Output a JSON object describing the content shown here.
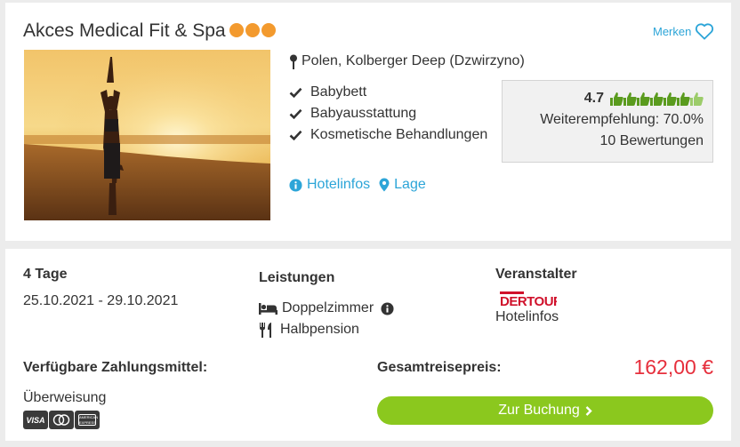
{
  "hotel": {
    "name": "Akces Medical Fit & Spa",
    "star_count": 3,
    "star_color": "#f39a2e",
    "location": "Polen, Kolberger Deep (Dzwirzyno)",
    "features": [
      "Babybett",
      "Babyausstattung",
      "Kosmetische Behandlungen"
    ]
  },
  "actions": {
    "merken_label": "Merken",
    "hotelinfos_link": "Hotelinfos",
    "lage_link": "Lage"
  },
  "rating": {
    "score": "4.7",
    "thumbs_full": 6,
    "thumbs_total": 7,
    "recommendation": "Weiterempfehlung: 70.0%",
    "reviews": "10 Bewertungen",
    "thumb_color": "#5a9b1e",
    "thumb_light_color": "#9ccc6a"
  },
  "offer": {
    "duration": "4 Tage",
    "dates": "25.10.2021 - 29.10.2021",
    "services_heading": "Leistungen",
    "room": "Doppelzimmer",
    "board": "Halbpension",
    "operator_heading": "Veranstalter",
    "operator_logo_text": "DERTOUR",
    "operator_link": "Hotelinfos",
    "payment_heading": "Verfügbare Zahlungsmittel:",
    "payment_method": "Überweisung",
    "payment_cards": [
      "VISA",
      "mastercard",
      "american express"
    ],
    "total_label": "Gesamtreisepreis:",
    "total_price": "162,00 €",
    "book_button": "Zur Buchung"
  },
  "colors": {
    "accent_blue": "#2ca5d8",
    "price_red": "#e62f3c",
    "book_green": "#8bc81e"
  }
}
